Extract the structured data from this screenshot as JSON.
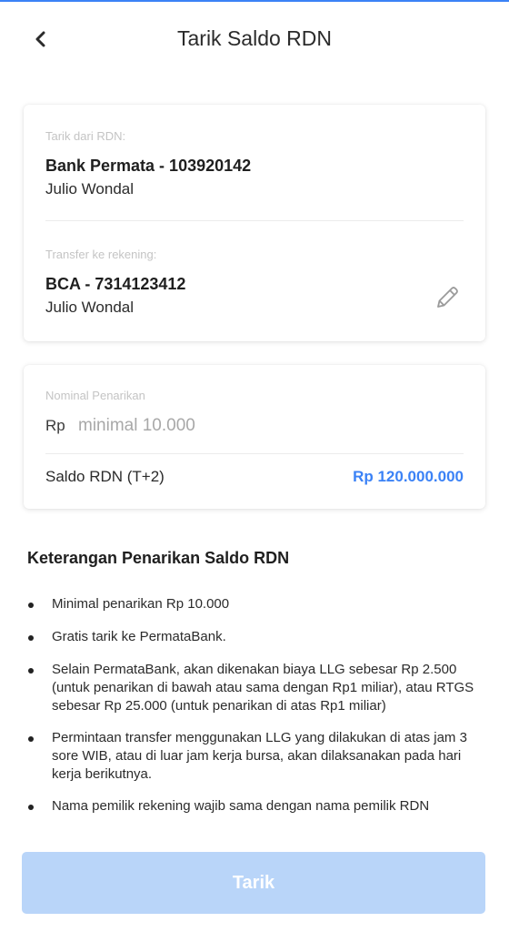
{
  "header": {
    "title": "Tarik Saldo RDN",
    "back_icon": "chevron-left-icon"
  },
  "source": {
    "label": "Tarik dari RDN:",
    "account": "Bank Permata - 103920142",
    "holder": "Julio Wondal"
  },
  "destination": {
    "label": "Transfer ke rekening:",
    "account": "BCA - 7314123412",
    "holder": "Julio Wondal",
    "edit_icon": "pencil-icon"
  },
  "amount": {
    "label": "Nominal Penarikan",
    "currency_prefix": "Rp",
    "placeholder": "minimal 10.000",
    "value": ""
  },
  "balance": {
    "label": "Saldo RDN (T+2)",
    "value": "Rp 120.000.000"
  },
  "info": {
    "title": "Keterangan Penarikan Saldo RDN",
    "notes": [
      "Minimal penarikan Rp 10.000",
      "Gratis tarik ke PermataBank.",
      "Selain PermataBank, akan dikenakan biaya LLG sebesar Rp 2.500 (untuk penarikan di bawah atau sama dengan Rp1 miliar), atau RTGS sebesar Rp 25.000 (untuk penarikan di atas Rp1 miliar)",
      "Permintaan transfer menggunakan LLG yang dilakukan di atas jam 3 sore WIB, atau di luar jam kerja bursa, akan dilaksanakan pada hari kerja berikutnya.",
      "Nama pemilik rekening wajib sama dengan nama pemilik RDN"
    ]
  },
  "submit": {
    "label": "Tarik",
    "enabled": false
  },
  "colors": {
    "accent": "#3b82f6",
    "button_disabled": "#b9d5f9"
  }
}
